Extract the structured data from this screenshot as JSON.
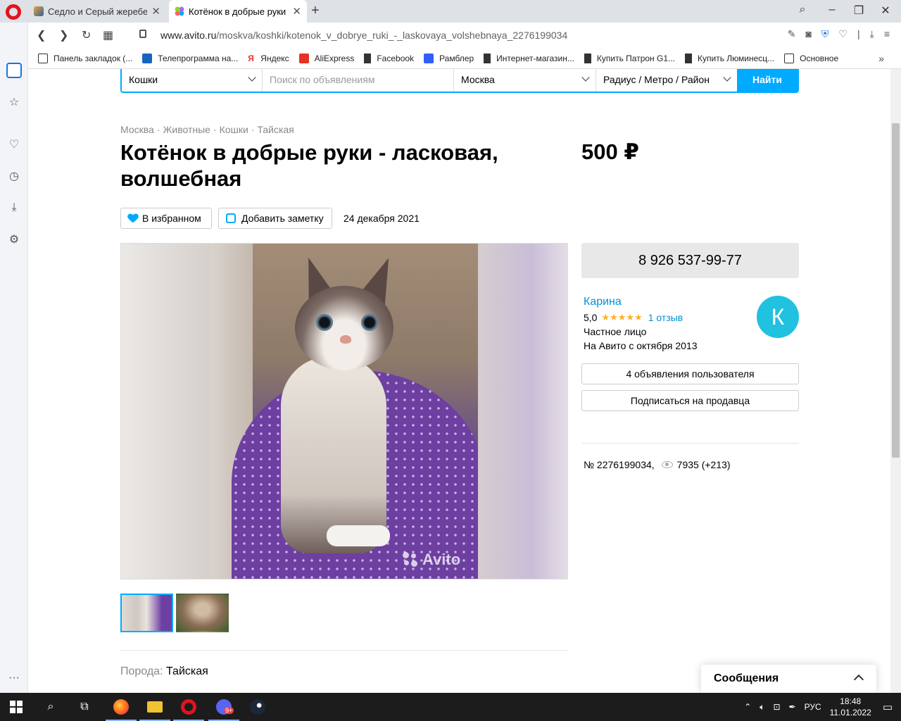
{
  "browser": {
    "tabs": [
      {
        "title": "Седло и Серый жеребец |",
        "active": false
      },
      {
        "title": "Котёнок в добрые руки - л",
        "active": true
      }
    ],
    "url_domain": "www.avito.ru",
    "url_path": "/moskva/koshki/kotenok_v_dobrye_ruki_-_laskovaya_volshebnaya_2276199034",
    "bookmarks": [
      "Панель закладок (...",
      "Телепрограмма на...",
      "Яндекс",
      "AliExpress",
      "Facebook",
      "Рамблер",
      "Интернет-магазин...",
      "Купить Патрон G1...",
      "Купить Люминесц...",
      "Основное"
    ]
  },
  "search": {
    "category": "Кошки",
    "query_placeholder": "Поиск по объявлениям",
    "city": "Москва",
    "radius": "Радиус / Метро / Район",
    "submit": "Найти"
  },
  "breadcrumbs": [
    "Москва",
    "Животные",
    "Кошки",
    "Тайская"
  ],
  "breadcrumb_separator": "·",
  "listing": {
    "title": "Котёнок в добрые руки - ласковая, волшебная",
    "price": "500 ₽",
    "favorite_label": "В избранном",
    "note_label": "Добавить заметку",
    "date": "24 декабря 2021",
    "watermark": "Avito",
    "breed_label": "Порода:",
    "breed_value": "Тайская"
  },
  "seller": {
    "phone": "8 926 537-99-77",
    "name": "Карина",
    "rating": "5,0",
    "stars": "★★★★★",
    "reviews": "1 отзыв",
    "type": "Частное лицо",
    "since": "На Авито с октября 2013",
    "avatar_letter": "К",
    "listings_button": "4 объявления пользователя",
    "subscribe_button": "Подписаться на продавца",
    "ad_number": "№ 2276199034,",
    "views": "7935 (+213)"
  },
  "messages": {
    "label": "Сообщения"
  },
  "taskbar": {
    "lang": "РУС",
    "time": "18:48",
    "date": "11.01.2022",
    "discord_badge": "9+"
  },
  "colors": {
    "accent": "#00aaff",
    "link": "#0091d9",
    "star": "#ffb021",
    "avatar": "#21c1e0"
  }
}
